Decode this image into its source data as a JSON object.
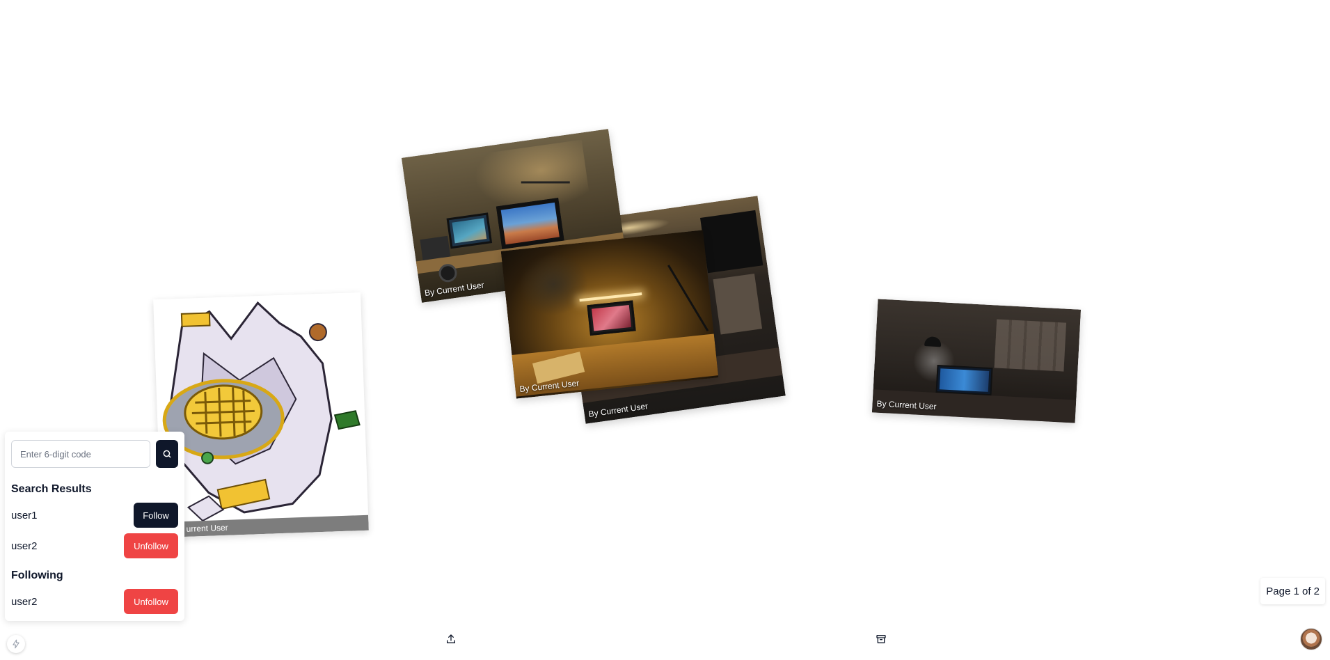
{
  "photos": [
    {
      "caption": "By Current User"
    },
    {
      "caption": "By Current User"
    },
    {
      "caption": "By Current User"
    },
    {
      "caption": "By Current User"
    },
    {
      "caption": "urrent User"
    }
  ],
  "search": {
    "placeholder": "Enter 6-digit code",
    "value": "",
    "button_icon": "search-icon"
  },
  "search_results": {
    "title": "Search Results",
    "users": [
      {
        "name": "user1",
        "action": "Follow"
      },
      {
        "name": "user2",
        "action": "Unfollow"
      }
    ]
  },
  "following": {
    "title": "Following",
    "users": [
      {
        "name": "user2",
        "action": "Unfollow"
      }
    ]
  },
  "pagination": {
    "label": "Page 1 of 2"
  },
  "bottom_bar": {
    "left_icon": "bolt-icon",
    "upload_icon": "upload-icon",
    "archive_icon": "archive-icon",
    "avatar": "user-avatar"
  },
  "colors": {
    "primary": "#0f172a",
    "danger": "#ef4444",
    "background": "#ffffff"
  }
}
